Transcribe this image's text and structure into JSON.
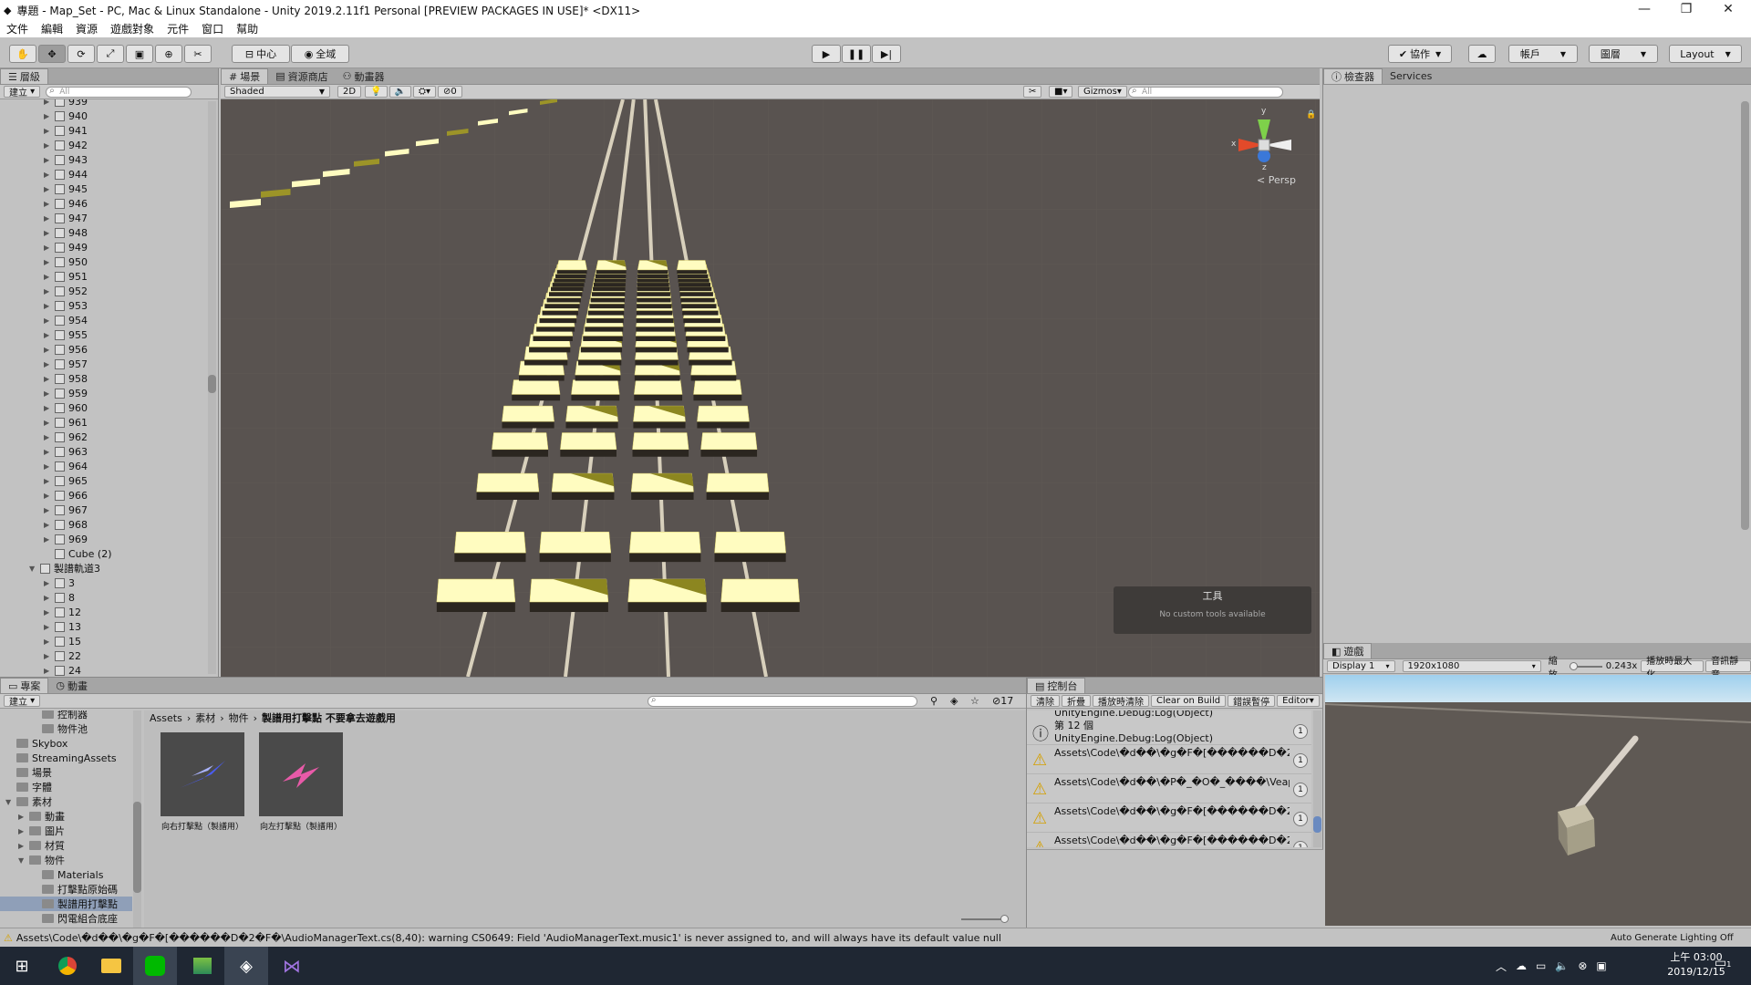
{
  "window": {
    "title": "專題 - Map_Set - PC, Mac & Linux Standalone - Unity 2019.2.11f1 Personal [PREVIEW PACKAGES IN USE]* <DX11>"
  },
  "menu": [
    "文件",
    "編輯",
    "資源",
    "遊戲對象",
    "元件",
    "窗口",
    "幫助"
  ],
  "toolbar": {
    "pivot_label": "中心",
    "global_label": "全域",
    "collab_label": "協作",
    "account_label": "帳戶",
    "layers_label": "圖層",
    "layout_label": "Layout"
  },
  "hierarchy": {
    "tab_label": "層級",
    "create_label": "建立",
    "search_placeholder": "All",
    "items": [
      "939",
      "940",
      "941",
      "942",
      "943",
      "944",
      "945",
      "946",
      "947",
      "948",
      "949",
      "950",
      "951",
      "952",
      "953",
      "954",
      "955",
      "956",
      "957",
      "958",
      "959",
      "960",
      "961",
      "962",
      "963",
      "964",
      "965",
      "966",
      "967",
      "968",
      "969"
    ],
    "cube_item": "Cube (2)",
    "group_label": "製譜軌道3",
    "group_items": [
      "3",
      "8",
      "12",
      "13",
      "15",
      "22",
      "24"
    ]
  },
  "scene": {
    "tabs": [
      "場景",
      "資源商店",
      "動畫器"
    ],
    "shading": "Shaded",
    "mode_2d": "2D",
    "hidden_count": "0",
    "gizmos_label": "Gizmos",
    "search_placeholder": "All",
    "persp_label": "< Persp",
    "axis_x": "x",
    "axis_y": "y",
    "axis_z": "z",
    "tools_title": "工具",
    "tools_msg": "No custom tools available"
  },
  "inspector": {
    "tabs": [
      "檢查器",
      "Services"
    ]
  },
  "game": {
    "tab_label": "遊戲",
    "display": "Display 1",
    "resolution": "1920x1080",
    "scale_label": "縮放",
    "scale_value": "0.243x",
    "maximize_label": "播放時最大化",
    "mute_label": "音訊靜音"
  },
  "project": {
    "tabs": [
      "專案",
      "動畫"
    ],
    "create_label": "建立",
    "hidden_count": "17",
    "breadcrumb": [
      "Assets",
      "素材",
      "物件",
      "製譜用打擊點 不要拿去遊戲用"
    ],
    "tree": [
      {
        "label": "控制器",
        "indent": 3
      },
      {
        "label": "物件池",
        "indent": 3
      },
      {
        "label": "Skybox",
        "indent": 1
      },
      {
        "label": "StreamingAssets",
        "indent": 1
      },
      {
        "label": "場景",
        "indent": 1
      },
      {
        "label": "字體",
        "indent": 1
      },
      {
        "label": "素材",
        "indent": 1
      },
      {
        "label": "動畫",
        "indent": 2
      },
      {
        "label": "圖片",
        "indent": 2
      },
      {
        "label": "材質",
        "indent": 2
      },
      {
        "label": "物件",
        "indent": 2
      },
      {
        "label": "Materials",
        "indent": 3
      },
      {
        "label": "打擊點原始碼",
        "indent": 3
      },
      {
        "label": "製譜用打擊點",
        "indent": 3
      },
      {
        "label": "閃電組合底座",
        "indent": 3
      }
    ],
    "assets": [
      {
        "label": "向右打擊點（製譜用）",
        "color": "#4a5cf0"
      },
      {
        "label": "向左打擊點（製譜用）",
        "color": "#e85aa8"
      }
    ]
  },
  "console": {
    "tab_label": "控制台",
    "buttons": [
      "清除",
      "折疊",
      "播放時清除",
      "Clear on Build",
      "錯誤暫停",
      "Editor"
    ],
    "top_partial": "UnityEngine.Debug:Log(Object)",
    "entries": [
      {
        "type": "info",
        "line1": "第 12 個",
        "line2": "UnityEngine.Debug:Log(Object)",
        "count": "1"
      },
      {
        "type": "warning",
        "line1": "Assets\\Code\\�d��\\�g�F�[������D�2",
        "line2": "",
        "count": "1"
      },
      {
        "type": "warning",
        "line1": "Assets\\Code\\�d��\\�P�_�O�_����\\Veap",
        "line2": "",
        "count": "1"
      },
      {
        "type": "warning",
        "line1": "Assets\\Code\\�d��\\�g�F�[������D�2",
        "line2": "",
        "count": "1"
      },
      {
        "type": "warning",
        "line1": "Assets\\Code\\�d��\\�g�F�[������D�2",
        "line2": "",
        "count": "1"
      }
    ]
  },
  "status": {
    "message": "Assets\\Code\\�d��\\�g�F�[������D�2�F�\\AudioManagerText.cs(8,40): warning CS0649: Field 'AudioManagerText.music1' is never assigned to, and will always have its default value null",
    "lighting": "Auto Generate Lighting Off"
  },
  "taskbar": {
    "time": "上午 03:00",
    "date": "2019/12/15",
    "notif_count": "1"
  },
  "colors": {
    "accent_yellow": "#f6f064",
    "scene_bg": "#595350",
    "taskbar": "#1f2733"
  }
}
